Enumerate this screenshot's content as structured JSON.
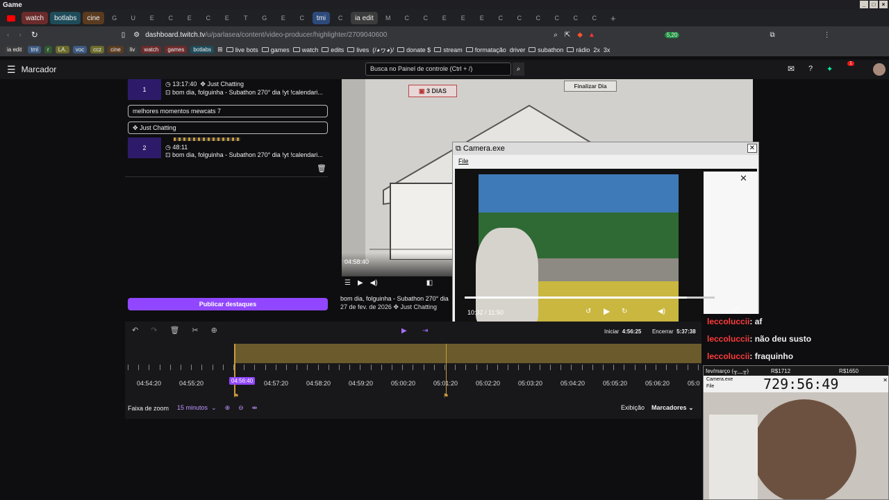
{
  "titlebar": {
    "title": "Game"
  },
  "tabs": {
    "labeled": [
      "watch",
      "botlabs",
      "cine",
      "tmi",
      "ia edit"
    ],
    "small": [
      "G",
      "U",
      "E",
      "C",
      "E",
      "C",
      "E",
      "T",
      "G",
      "E",
      "C",
      "C",
      "M",
      "C",
      "C",
      "E",
      "E",
      "E",
      "C",
      "C",
      "C",
      "C",
      "C",
      "C"
    ]
  },
  "address": {
    "url_host": "dashboard.twitch.tv",
    "url_path": "/u/parlasea/content/video-producer/highlighter/2709040600",
    "badge": "5,20"
  },
  "bookmarks": {
    "tags": [
      "ia edit",
      "tml",
      "r",
      "LA.",
      "voc",
      "ccz",
      "cine",
      "liv",
      "watch",
      "games",
      "botlabs"
    ],
    "items": [
      "live bots",
      "games",
      "watch",
      "edits",
      "lives",
      "(/◕ヮ◕)/",
      "donate $",
      "stream",
      "formatação",
      "driver",
      "subathon",
      "rádio",
      "2x",
      "3x"
    ]
  },
  "header": {
    "title": "Marcador",
    "search_placeholder": "Busca no Painel de controle (Ctrl + /)",
    "notif_count": "1"
  },
  "highlights": [
    {
      "num": "1",
      "time": "13:17:40",
      "category": "Just Chatting",
      "title": "bom dia, folguinha - Subathon 270° dia !yt !calendari..."
    },
    {
      "num": "2",
      "time": "48:11",
      "title": "bom dia, folguinha - Subathon 270° dia !yt !calendari..."
    }
  ],
  "editor": {
    "title_value": "melhores momentos mewcats 7",
    "category_value": "Just Chatting",
    "publish_label": "Publicar destaques"
  },
  "game": {
    "days_label": "3 DIAS",
    "finish_label": "Finalizar Dia",
    "timestamp": "04:58:40"
  },
  "video_info": {
    "title": "bom dia, folguinha - Subathon 270° dia",
    "date": "27 de fev. de 2026",
    "category": "Just Chatting"
  },
  "camera": {
    "title": "Camera.exe",
    "menu": "File",
    "time": "10:32 / 11:50"
  },
  "timeline": {
    "labels": [
      "04:54:20",
      "04:55:20",
      "04:56:40",
      "04:57:20",
      "04:58:20",
      "04:59:20",
      "05:00:20",
      "05:01:20",
      "05:02:20",
      "05:03:20",
      "05:04:20",
      "05:05:20",
      "05:06:20",
      "05:0"
    ],
    "cursor": "04:56:40",
    "start_label": "Iniciar",
    "start_time": "4:56:25",
    "end_label": "Encerrar",
    "end_time": "5:37:38",
    "zoom_label": "Faixa de zoom",
    "zoom_value": "15 minutos",
    "view_label": "Exibição",
    "view_value": "Marcadores"
  },
  "chat": [
    {
      "user": "leccoluccii",
      "msg": ": af"
    },
    {
      "user": "leccoluccii",
      "msg": ": não deu susto"
    },
    {
      "user": "leccoluccii",
      "msg": ": fraquinho"
    }
  ],
  "overlay": {
    "date": "fev/março (╥﹏╥)",
    "val1": "R$1712",
    "val2": "R$1650",
    "timer": "729:56:49",
    "cam_title": "Camera.exe",
    "cam_menu": "File"
  },
  "colors": {
    "accent": "#9147ff",
    "chat_user": "#ff3b3b",
    "timeline_bar": "#6b5a2c"
  }
}
